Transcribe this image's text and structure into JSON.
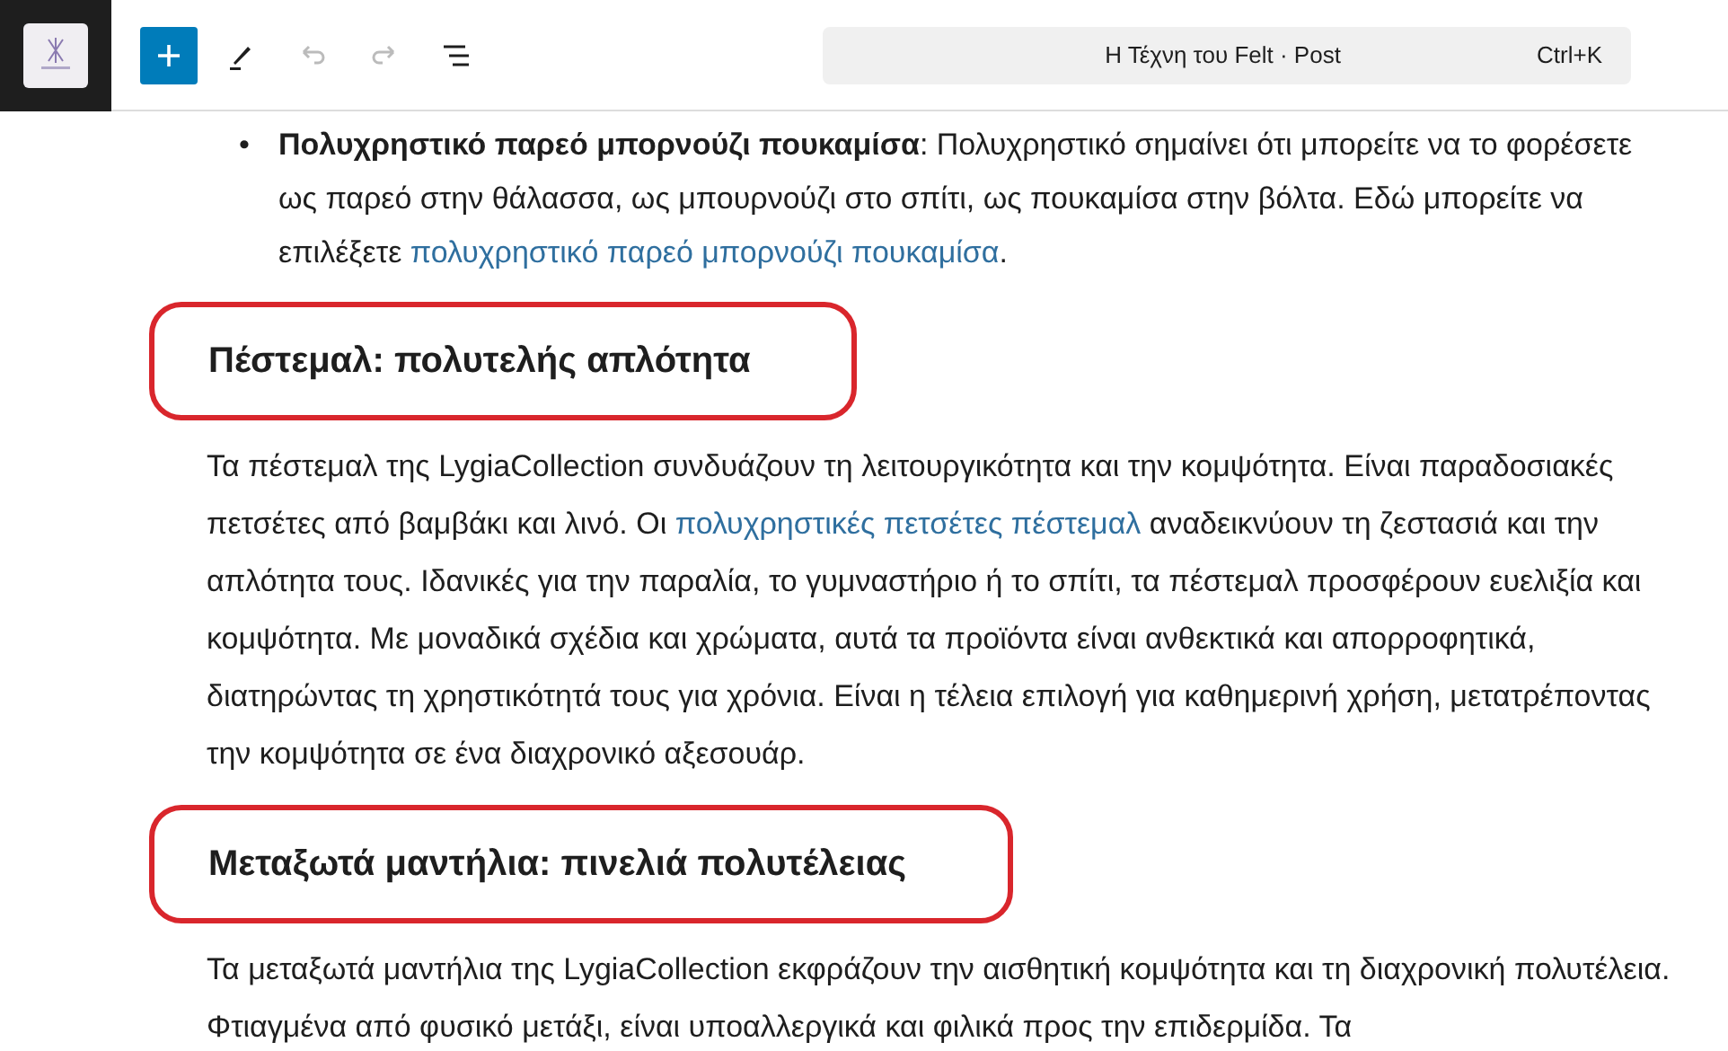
{
  "toolbar": {
    "buttons": [
      {
        "kind": "add",
        "disabled": false
      },
      {
        "kind": "pen",
        "disabled": false
      },
      {
        "kind": "undo",
        "disabled": true
      },
      {
        "kind": "redo",
        "disabled": true
      },
      {
        "kind": "outline",
        "disabled": false
      }
    ],
    "document_title": "Η Τέχνη του Felt · Post",
    "shortcut": "Ctrl+K"
  },
  "content": [
    {
      "kind": "list",
      "items": [
        {
          "marker": "•",
          "segments": [
            {
              "text": "**Πολυχρηστικό παρεό μπορνούζι πουκαμίσα**: Πολυχρηστικό σημαίνει ότι μπορείτε να το φορέσετε ως παρεό στην θάλασσα, ως μπουρνούζι στο σπίτι, ως πουκαμίσα στην βόλτα. Εδώ μπορείτε να επιλέξετε ",
              "link": false
            },
            {
              "text": "πολυχρηστικό παρεό μπορνούζι πουκαμίσα",
              "link": true
            },
            {
              "text": ".",
              "link": false
            }
          ]
        }
      ]
    },
    {
      "kind": "heading",
      "text": "Πέστεμαλ: πολυτελής απλότητα",
      "highlighted": true
    },
    {
      "kind": "paragraph",
      "segments": [
        {
          "text": "Τα πέστεμαλ της LygiaCollection συνδυάζουν τη λειτουργικότητα και την κομψότητα. Είναι παραδοσιακές πετσέτες από βαμβάκι και λινό. Οι ",
          "link": false
        },
        {
          "text": "πολυχρηστικές πετσέτες πέστεμαλ",
          "link": true
        },
        {
          "text": " αναδεικνύουν τη ζεστασιά και την απλότητα τους. Ιδανικές για την παραλία, το γυμναστήριο ή το σπίτι, τα πέστεμαλ προσφέρουν ευελιξία και κομψότητα. Με μοναδικά σχέδια και χρώματα, αυτά τα προϊόντα είναι ανθεκτικά και απορροφητικά, διατηρώντας τη χρηστικότητά τους για χρόνια. Είναι η τέλεια επιλογή για καθημερινή χρήση, μετατρέποντας την κομψότητα σε ένα διαχρονικό αξεσουάρ.",
          "link": false
        }
      ]
    },
    {
      "kind": "heading",
      "text": "Μεταξωτά μαντήλια: πινελιά πολυτέλειας",
      "highlighted": true
    },
    {
      "kind": "paragraph",
      "segments": [
        {
          "text": "Τα μεταξωτά μαντήλια της LygiaCollection εκφράζουν την αισθητική κομψότητα και τη διαχρονική πολυτέλεια. Φτιαγμένα από φυσικό μετάξι, είναι υποαλλεργικά και φιλικά προς την επιδερμίδα. Τα",
          "link": false
        }
      ]
    }
  ]
}
